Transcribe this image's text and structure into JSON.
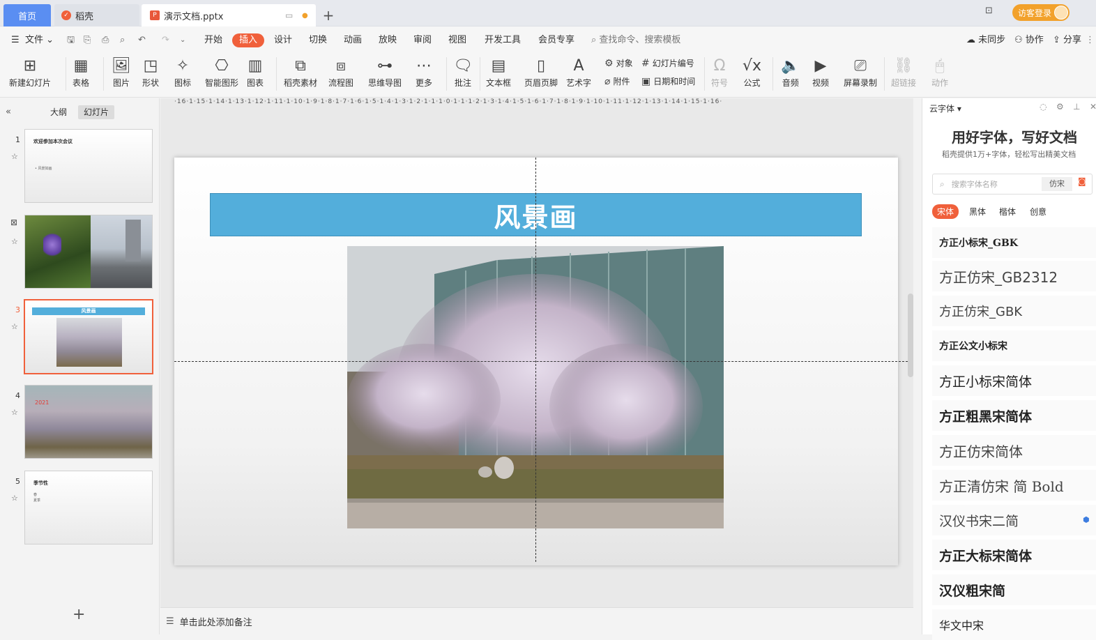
{
  "titlebar": {
    "home": "首页",
    "daoke": "稻壳",
    "doc": "演示文档.pptx",
    "login": "访客登录"
  },
  "menu": {
    "file": "文件",
    "items": [
      "开始",
      "插入",
      "设计",
      "切换",
      "动画",
      "放映",
      "审阅",
      "视图",
      "开发工具",
      "会员专享"
    ],
    "search": "查找命令、搜索模板",
    "unsynced": "未同步",
    "collab": "协作",
    "share": "分享"
  },
  "ribbon": {
    "new_slide": "新建幻灯片",
    "table": "表格",
    "picture": "图片",
    "shape": "形状",
    "icon": "图标",
    "smart": "智能图形",
    "chart": "图表",
    "daoke_material": "稻壳素材",
    "flowchart": "流程图",
    "mindmap": "思维导图",
    "more": "更多",
    "comment": "批注",
    "textbox": "文本框",
    "header_footer": "页眉页脚",
    "wordart": "艺术字",
    "object": "对象",
    "slide_number": "幻灯片编号",
    "attachment": "附件",
    "datetime": "日期和时间",
    "symbol": "符号",
    "formula": "公式",
    "audio": "音频",
    "video": "视频",
    "screen_record": "屏幕录制",
    "hyperlink": "超链接",
    "action": "动作"
  },
  "leftpane": {
    "outline": "大纲",
    "slides": "幻灯片",
    "add": "+"
  },
  "thumbs": [
    {
      "num": "1",
      "title": "欢迎参加本次会议",
      "sub": "• 风景如画"
    },
    {
      "num": "2"
    },
    {
      "num": "3",
      "title": "风景画"
    },
    {
      "num": "4",
      "label": "2021"
    },
    {
      "num": "5",
      "title": "季节性",
      "sub1": "春",
      "sub2": "夏季"
    }
  ],
  "ruler": "·16·1·15·1·14·1·13·1·12·1·11·1·10·1·9·1·8·1·7·1·6·1·5·1·4·1·3·1·2·1·1·1·0·1·1·1·2·1·3·1·4·1·5·1·6·1·7·1·8·1·9·1·10·1·11·1·12·1·13·1·14·1·15·1·16·",
  "slide": {
    "title": "风景画"
  },
  "notes": "单击此处添加备注",
  "rightpane": {
    "header": "云字体",
    "headline": "用好字体，写好文档",
    "subline": "稻壳提供1万+字体，轻松写出精美文档",
    "search_placeholder": "搜索字体名称",
    "search_hint": "仿宋",
    "cats": [
      "宋体",
      "黑体",
      "楷体",
      "创意"
    ],
    "fonts": [
      "方正小标宋_GBK",
      "方正仿宋_GB2312",
      "方正仿宋_GBK",
      "方正公文小标宋",
      "方正小标宋简体",
      "方正粗黑宋简体",
      "方正仿宋简体",
      "方正清仿宋 简 Bold",
      "汉仪书宋二简",
      "方正大标宋简体",
      "汉仪粗宋简",
      "华文中宋"
    ]
  },
  "colors": {
    "accent": "#f0603b",
    "title_fill": "#53aedb",
    "home_tab": "#5a8ef2",
    "login": "#f2a12b"
  }
}
